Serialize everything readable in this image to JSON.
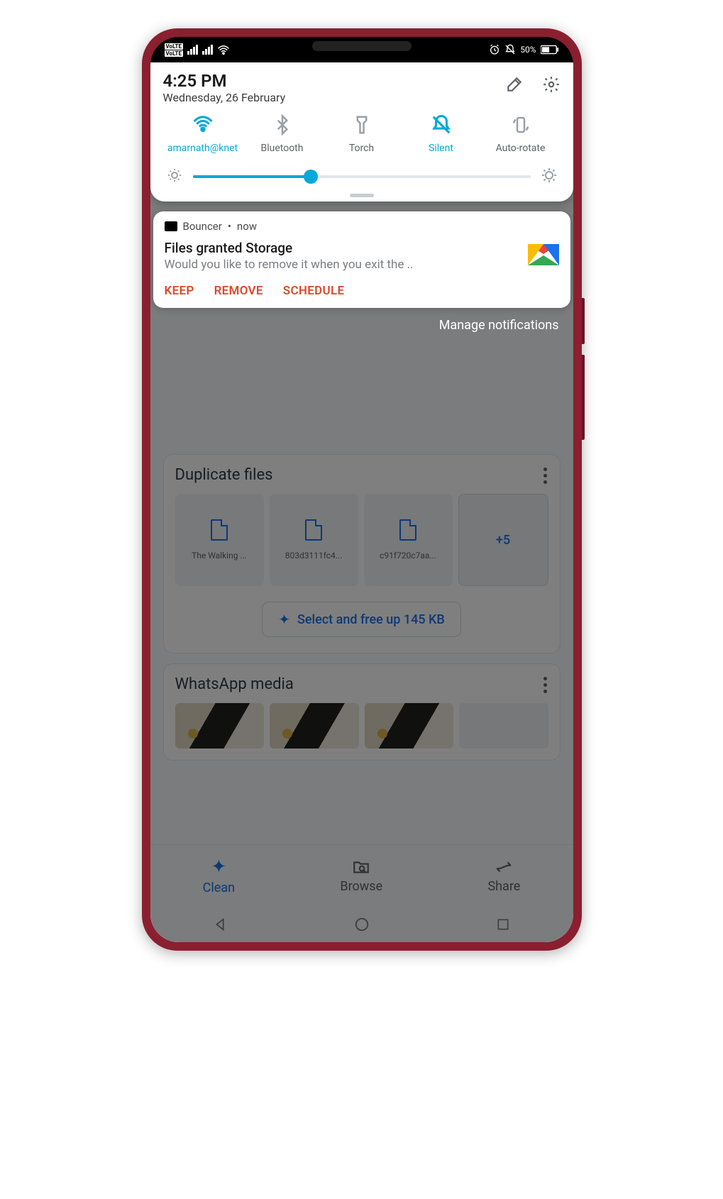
{
  "status": {
    "volte1": "VoLTE 1",
    "volte2": "VoLTE 2",
    "battery_pct": "50%"
  },
  "qs": {
    "time": "4:25 PM",
    "date": "Wednesday, 26 February",
    "toggles": {
      "wifi": "amarnath@knet",
      "bluetooth": "Bluetooth",
      "torch": "Torch",
      "silent": "Silent",
      "autorotate": "Auto-rotate"
    },
    "brightness_pct": 35
  },
  "notification": {
    "app": "Bouncer",
    "time_label": "now",
    "title": "Files granted Storage",
    "desc": "Would you like to remove it when you exit the ..",
    "actions": {
      "keep": "KEEP",
      "remove": "REMOVE",
      "schedule": "SCHEDULE"
    }
  },
  "manage_label": "Manage notifications",
  "bg": {
    "duplicate": {
      "title": "Duplicate files",
      "files": [
        "The Walking ...",
        "803d3111fc4...",
        "c91f720c7aa..."
      ],
      "more": "+5",
      "select_label": "Select and free up 145 KB"
    },
    "whatsapp": {
      "title": "WhatsApp media"
    },
    "nav": {
      "clean": "Clean",
      "browse": "Browse",
      "share": "Share"
    }
  }
}
